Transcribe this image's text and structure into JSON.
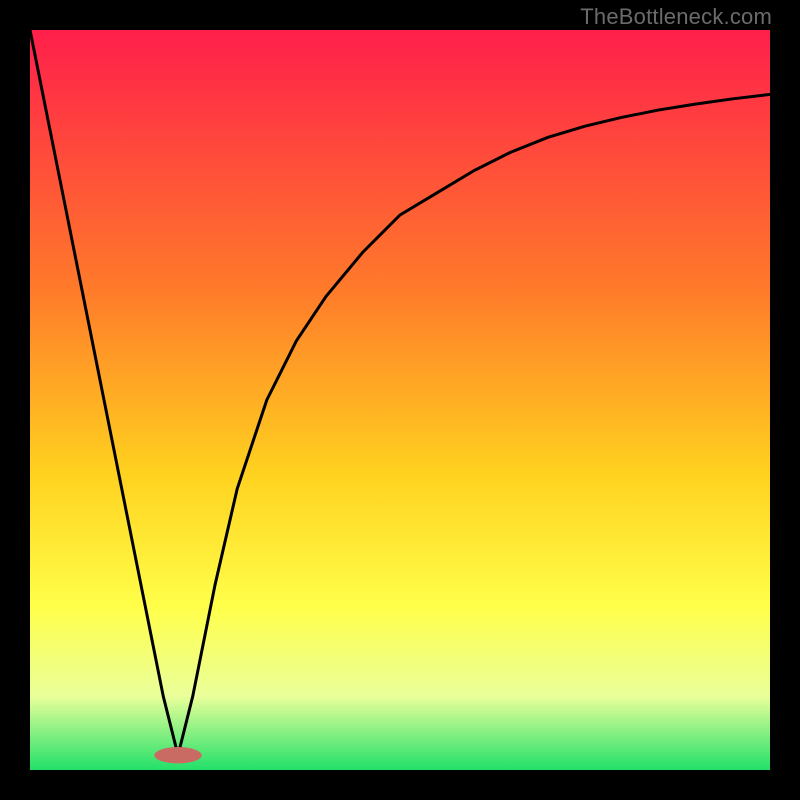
{
  "watermark": "TheBottleneck.com",
  "chart_data": {
    "type": "line",
    "title": "",
    "xlabel": "",
    "ylabel": "",
    "xlim": [
      0,
      100
    ],
    "ylim": [
      0,
      100
    ],
    "gradient_stops": [
      {
        "offset": 0,
        "color": "#ff1f4b"
      },
      {
        "offset": 35,
        "color": "#ff7a2a"
      },
      {
        "offset": 60,
        "color": "#ffd21f"
      },
      {
        "offset": 78,
        "color": "#ffff4a"
      },
      {
        "offset": 90,
        "color": "#eaff9a"
      },
      {
        "offset": 100,
        "color": "#22e06a"
      }
    ],
    "series": [
      {
        "name": "curve",
        "x": [
          0,
          5,
          10,
          15,
          18,
          20,
          22,
          25,
          28,
          32,
          36,
          40,
          45,
          50,
          55,
          60,
          65,
          70,
          75,
          80,
          85,
          90,
          95,
          100
        ],
        "y": [
          100,
          75,
          50,
          25,
          10,
          2,
          10,
          25,
          38,
          50,
          58,
          64,
          70,
          75,
          78,
          81,
          83.5,
          85.5,
          87,
          88.2,
          89.2,
          90,
          90.7,
          91.3
        ]
      }
    ],
    "marker": {
      "x": 20,
      "y": 2,
      "rx": 3.2,
      "ry": 1.1,
      "color": "#c96a63"
    }
  }
}
